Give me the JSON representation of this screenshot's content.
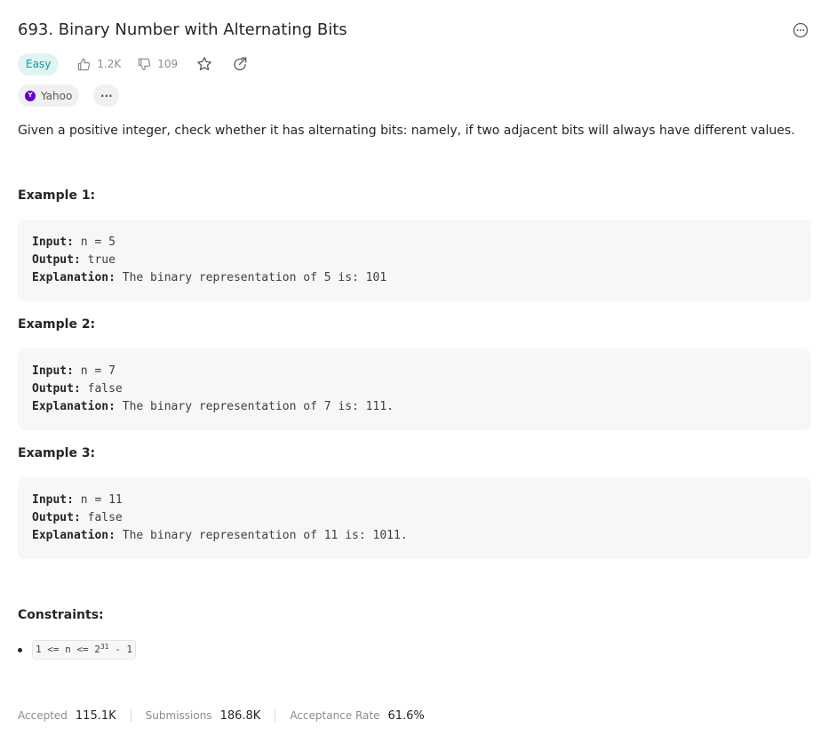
{
  "problem": {
    "title": "693. Binary Number with Alternating Bits",
    "difficulty": "Easy",
    "likes": "1.2K",
    "dislikes": "109",
    "company": "Yahoo",
    "more_tags": "···",
    "description": "Given a positive integer, check whether it has alternating bits: namely, if two adjacent bits will always have different values."
  },
  "examples": [
    {
      "heading": "Example 1:",
      "input_label": "Input:",
      "input_value": "n = 5",
      "output_label": "Output:",
      "output_value": "true",
      "explanation_label": "Explanation:",
      "explanation_value": "The binary representation of 5 is: 101"
    },
    {
      "heading": "Example 2:",
      "input_label": "Input:",
      "input_value": "n = 7",
      "output_label": "Output:",
      "output_value": "false",
      "explanation_label": "Explanation:",
      "explanation_value": "The binary representation of 7 is: 111."
    },
    {
      "heading": "Example 3:",
      "input_label": "Input:",
      "input_value": "n = 11",
      "output_label": "Output:",
      "output_value": "false",
      "explanation_label": "Explanation:",
      "explanation_value": "The binary representation of 11 is: 1011."
    }
  ],
  "constraints": {
    "heading": "Constraints:",
    "item_prefix": "1 <= n <= 2",
    "item_exponent": "31",
    "item_suffix": " - 1"
  },
  "stats": {
    "accepted_label": "Accepted",
    "accepted_value": "115.1K",
    "submissions_label": "Submissions",
    "submissions_value": "186.8K",
    "rate_label": "Acceptance Rate",
    "rate_value": "61.6%"
  },
  "icons": {
    "more": "more-horizontal-circle-icon",
    "like": "thumbs-up-icon",
    "dislike": "thumbs-down-icon",
    "favorite": "star-icon",
    "share": "share-icon",
    "company_logo": "yahoo-logo-icon"
  },
  "colors": {
    "easy_text": "#00a09a",
    "easy_bg": "#e0f4f1",
    "yahoo_brand": "#6001d2"
  }
}
